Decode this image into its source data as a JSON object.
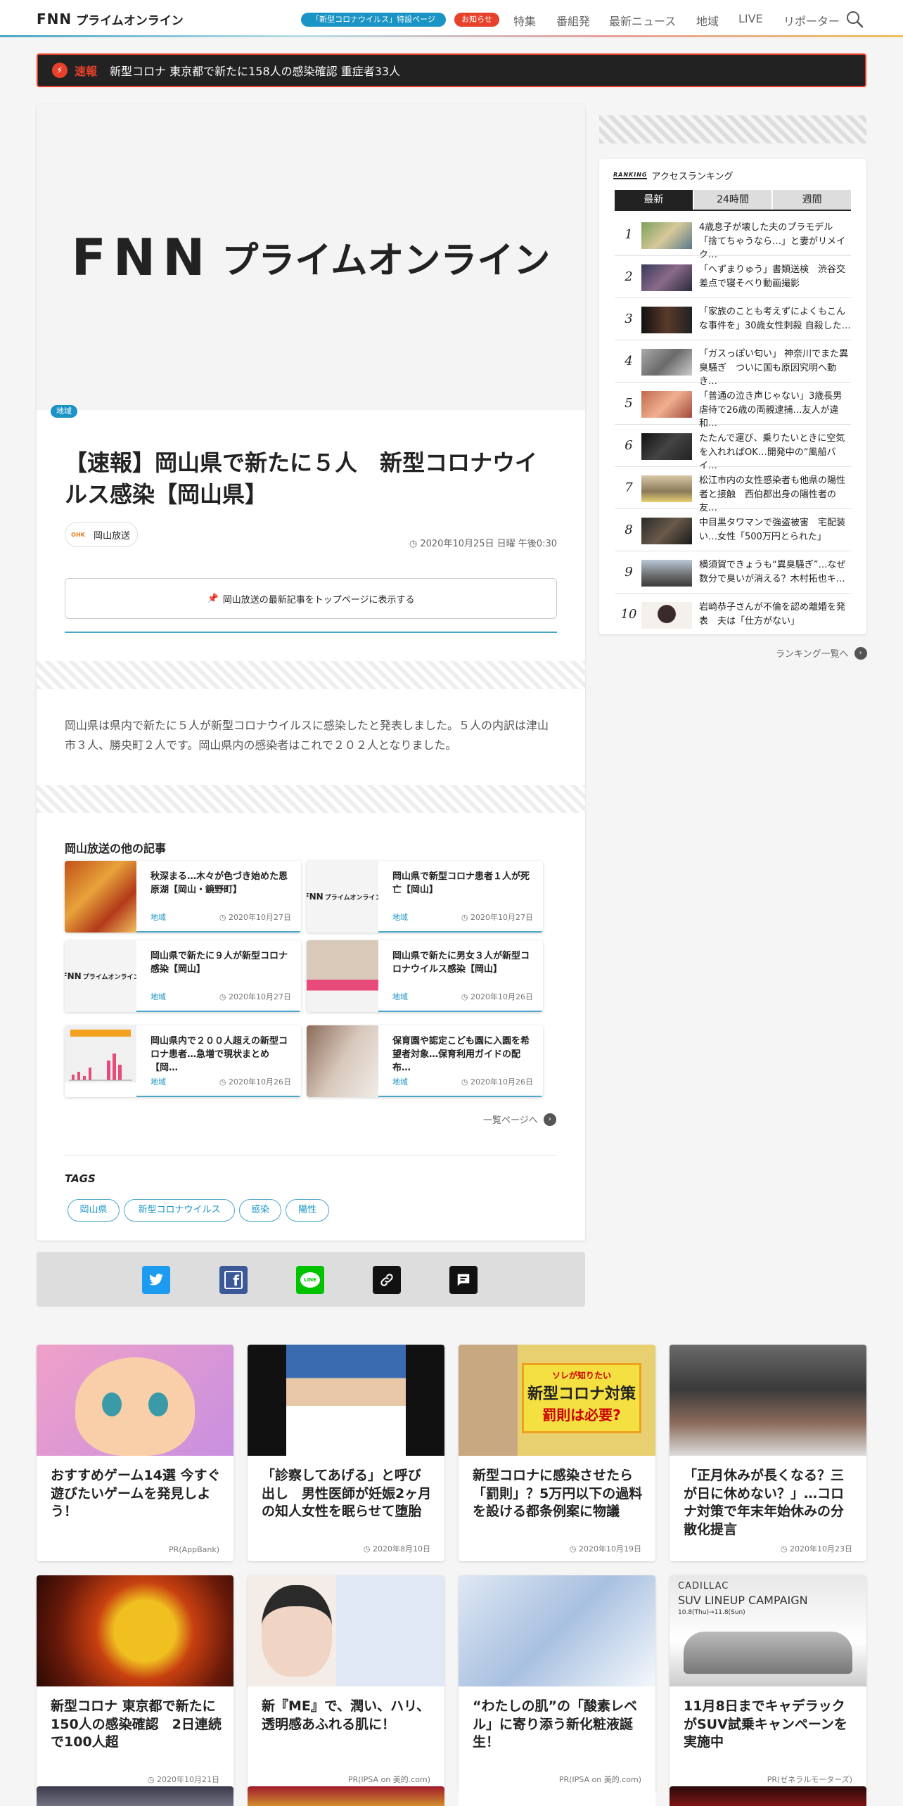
{
  "header": {
    "logo_letters": "FNN",
    "logo_kana": "プライムオンライン",
    "pill_special": "「新型コロナウイルス」特設ページ",
    "pill_notice": "お知らせ",
    "nav": [
      "特集",
      "番組発",
      "最新ニュース",
      "地域",
      "LIVE",
      "リポーター"
    ]
  },
  "breaking": {
    "label": "速報",
    "text": "新型コロナ 東京都で新たに158人の感染確認 重症者33人"
  },
  "article": {
    "hero_letters": "FNN",
    "hero_kana": "プライムオンライン",
    "category": "地域",
    "title": "【速報】岡山県で新たに５人　新型コロナウイルス感染【岡山県】",
    "source_logo": "OHK",
    "source": "岡山放送",
    "date": "2020年10月25日 日曜 午後0:30",
    "pin_button": "岡山放送の最新記事をトップページに表示する",
    "body": "岡山県は県内で新たに５人が新型コロナウイルスに感染したと発表しました。５人の内訳は津山市３人、勝央町２人です。岡山県内の感染者はこれで２０２人となりました。"
  },
  "other": {
    "heading": "岡山放送の他の記事",
    "items": [
      {
        "title": "秋深まる…木々が色づき始めた恩原湖【岡山・鏡野町】",
        "tag": "地域",
        "date": "2020年10月27日"
      },
      {
        "title": "岡山県で新型コロナ患者１人が死亡【岡山】",
        "tag": "地域",
        "date": "2020年10月27日"
      },
      {
        "title": "岡山県で新たに９人が新型コロナ感染【岡山】",
        "tag": "地域",
        "date": "2020年10月27日"
      },
      {
        "title": "岡山県で新たに男女３人が新型コロナウイルス感染【岡山】",
        "tag": "地域",
        "date": "2020年10月26日"
      },
      {
        "title": "岡山県内で２００人超えの新型コロナ患者…急増で現状まとめ【岡…",
        "tag": "地域",
        "date": "2020年10月26日"
      },
      {
        "title": "保育園や認定こども園に入園を希望者対象…保育利用ガイドの配布…",
        "tag": "地域",
        "date": "2020年10月26日"
      }
    ],
    "more": "一覧ページへ"
  },
  "tags": {
    "heading": "TAGS",
    "items": [
      "岡山県",
      "新型コロナウイルス",
      "感染",
      "陽性"
    ]
  },
  "ranking": {
    "badge": "RANKING",
    "heading": "アクセスランキング",
    "tabs": [
      "最新",
      "24時間",
      "週間"
    ],
    "items": [
      {
        "n": "1",
        "title": "4歳息子が壊した夫のプラモデル「捨てちゃうなら…」と妻がリメイク…"
      },
      {
        "n": "2",
        "title": "「へずまりゅう」書類送検　渋谷交差点で寝そべり動画撮影"
      },
      {
        "n": "3",
        "title": "「家族のことも考えずによくもこんな事件を」30歳女性刺殺 自殺した…"
      },
      {
        "n": "4",
        "title": "「ガスっぽい匂い」 神奈川でまた異臭騒ぎ　ついに国も原因究明へ動き…"
      },
      {
        "n": "5",
        "title": "「普通の泣き声じゃない」3歳長男虐待で26歳の両親逮捕…友人が違和…"
      },
      {
        "n": "6",
        "title": "たたんで運び、乗りたいときに空気を入れればOK…開発中の“風船バイ…"
      },
      {
        "n": "7",
        "title": "松江市内の女性感染者も他県の陽性者と接触　西伯郡出身の陽性者の友…"
      },
      {
        "n": "8",
        "title": "中目黒タワマンで強盗被害　宅配装い…女性「500万円とられた」"
      },
      {
        "n": "9",
        "title": "横須賀できょうも“異臭騒ぎ”…なぜ数分で臭いが消える？木村拓也キ…"
      },
      {
        "n": "10",
        "title": "岩崎恭子さんが不倫を認め離婚を発表　夫は「仕方がない」"
      }
    ],
    "more": "ランキング一覧へ"
  },
  "grid": [
    {
      "title": "おすすめゲーム14選 今すぐ遊びたいゲームを発見しよう！",
      "meta": "PR(AppBank)"
    },
    {
      "title": "「診察してあげる」と呼び出し　男性医師が妊娠2ヶ月の知人女性を眠らせて堕胎",
      "meta": "2020年8月10日"
    },
    {
      "title": "新型コロナに感染させたら「罰則」？5万円以下の過料を設ける都条例案に物議",
      "meta": "2020年10月19日"
    },
    {
      "title": "「正月休みが長くなる？三が日に休めない？」…コロナ対策で年末年始休みの分散化提言",
      "meta": "2020年10月23日"
    },
    {
      "title": "新型コロナ 東京都で新たに150人の感染確認　2日連続で100人超",
      "meta": "2020年10月21日"
    },
    {
      "title": "新『ME』で、潤い、ハリ、透明感あふれる肌に！",
      "meta": "PR(IPSA on 美的.com)"
    },
    {
      "title": "“わたしの肌”の「酸素レベル」に寄り添う新化粧液誕生！",
      "meta": "PR(IPSA on 美的.com)"
    },
    {
      "title": "11月8日までキャデラックがSUV試乗キャンペーンを実施中",
      "meta": "PR(ゼネラルモーターズ)"
    }
  ],
  "grid_image_text": {
    "banner_small": "ソレが知りたい",
    "banner_main": "新型コロナ対策",
    "banner_sub": "罰則は必要?",
    "cadillac_brand": "CADILLAC",
    "cadillac_campaign": "SUV LINEUP CAMPAIGN",
    "cadillac_dates": "10.8(Thu)→11.8(Sun)"
  },
  "colors": {
    "accent": "#1a94c4",
    "alert": "#e8412b",
    "dark": "#222222"
  }
}
